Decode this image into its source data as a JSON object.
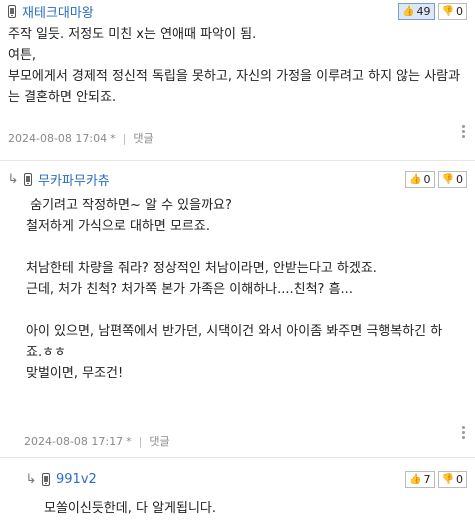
{
  "comments": [
    {
      "author": "재테크대마왕",
      "up": "49",
      "down": "0",
      "body": "주작 일듯. 저정도 미친 x는 연애때 파악이 됨.\n여튼,\n부모에게서 경제적 정신적 독립을 못하고, 자신의 가정을 이루려고 하지 않는 사람과는 결혼하면 안되죠.",
      "date": "2024-08-08 17:04",
      "star": "*",
      "reply_label": "댓글"
    },
    {
      "author": "무카파무카츄",
      "up": "0",
      "down": "0",
      "body": " 숨기려고 작정하면~ 알 수 있을까요?\n철저하게 가식으로 대하면 모르죠.\n\n처남한테 차량을 줘라? 정상적인 처남이라면, 안받는다고 하겠죠.\n근데, 처가 친척? 처가쪽 본가 가족은 이해하나....친척? 흠...\n\n아이 있으면, 남편쪽에서 반가던, 시댁이건 와서 아이좀 봐주면 극행복하긴 하죠.ㅎㅎ\n맞벌이면, 무조건!",
      "date": "2024-08-08 17:17",
      "star": "*",
      "reply_label": "댓글"
    },
    {
      "author": "991v2",
      "up": "7",
      "down": "0",
      "body": "모쏠이신듯한데, 다 알게됩니다."
    }
  ],
  "icons": {
    "thumb_up": "thumbs-up-icon",
    "thumb_down": "thumbs-down-icon",
    "mobile": "mobile-phone-icon",
    "reply": "reply-arrow-icon",
    "more": "more-vertical-icon"
  },
  "colors": {
    "author": "#2a6dc2",
    "active_vote_bg": "#dde8f7"
  }
}
